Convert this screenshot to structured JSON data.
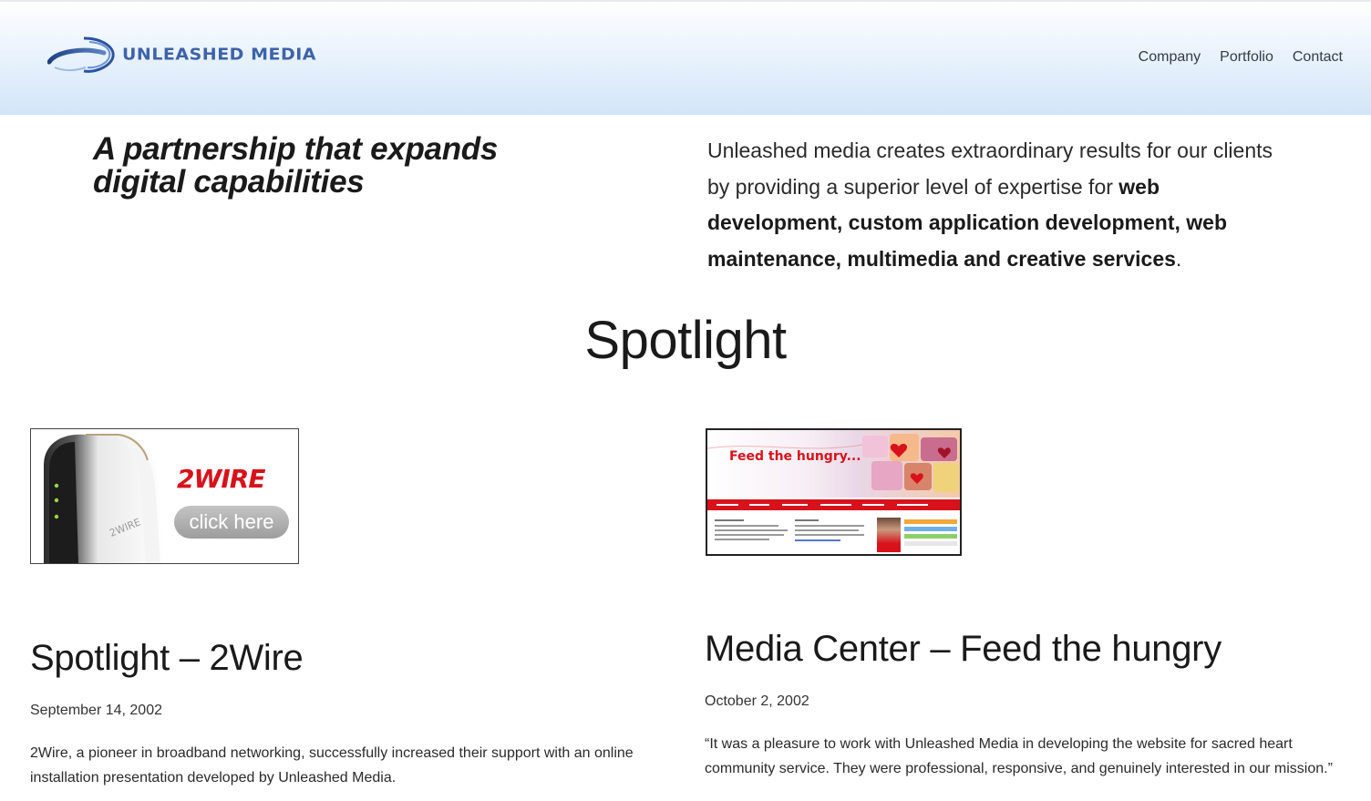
{
  "header": {
    "logo_text": "UNLEASHED MEDIA",
    "nav": [
      "Company",
      "Portfolio",
      "Contact"
    ]
  },
  "hero": {
    "tagline_line1": "A partnership that expands",
    "tagline_line2": "digital capabilities",
    "intro_plain": "Unleashed media creates extraordinary results for our clients by providing a superior level of expertise for",
    "intro_bold": "web development, custom application development, web maintenance, multimedia and creative services",
    "intro_end": "."
  },
  "section_title": "Spotlight",
  "posts": [
    {
      "title": "Spotlight – 2Wire",
      "date": "September 14, 2002",
      "excerpt": "2Wire, a pioneer in broadband networking, successfully increased their support with an online installation presentation developed by Unleashed Media.",
      "image_brand": "2WIRE",
      "image_button": "click here"
    },
    {
      "title": "Media Center – Feed the hungry",
      "date": "October 2, 2002",
      "excerpt": "“It was a pleasure to work with Unleashed Media in developing the website for sacred heart community service. They were professional, responsive, and genuinely interested in our mission.”",
      "image_heading": "Feed the hungry..."
    }
  ],
  "colors": {
    "logo_blue": "#3e63a8",
    "header_gradient_bottom": "#d2e6f8",
    "wire_red": "#d8121b"
  }
}
